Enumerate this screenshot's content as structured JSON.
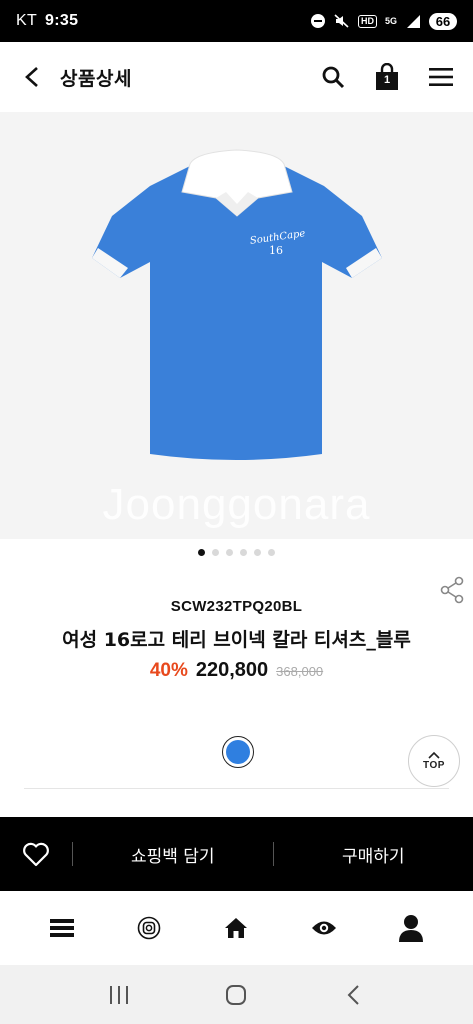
{
  "status_bar": {
    "carrier": "KT",
    "time": "9:35",
    "hd": "HD",
    "network": "5G",
    "battery": "66"
  },
  "header": {
    "title": "상품상세",
    "bag_count": "1"
  },
  "gallery": {
    "watermark": "Joonggonara",
    "shirt_text_1": "SouthCape",
    "shirt_text_2": "16",
    "page_count": 6,
    "active_page": 1
  },
  "product": {
    "code": "SCW232TPQ20BL",
    "name": "여성 16로고 테리 브이넥 칼라 티셔츠_블루",
    "discount": "40%",
    "sale_price": "220,800",
    "original_price": "368,000",
    "color_swatch": "#2f7fe0"
  },
  "top_button": {
    "label": "TOP"
  },
  "action_bar": {
    "cart_label": "쇼핑백 담기",
    "buy_label": "구매하기"
  },
  "colors": {
    "accent_discount": "#e8491d",
    "action_bar_bg": "#000000",
    "shirt_blue": "#3a80d9"
  }
}
